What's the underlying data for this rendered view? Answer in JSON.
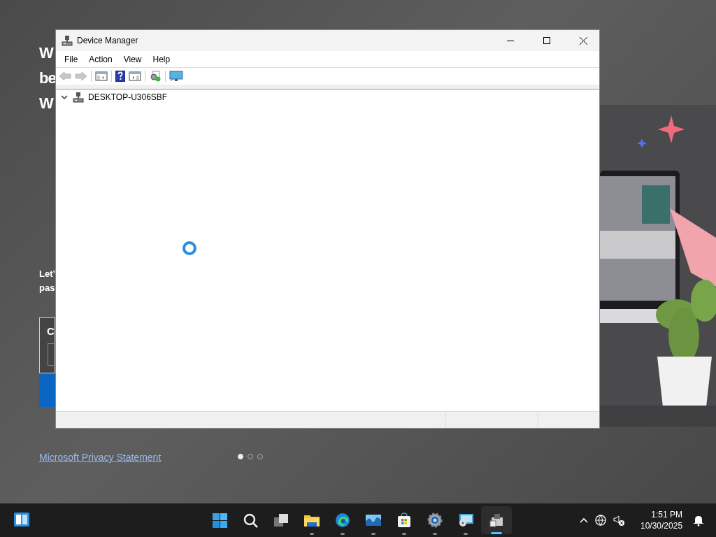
{
  "background_page": {
    "title_lines": [
      "W",
      "be",
      "W"
    ],
    "body_lines": [
      "Let’",
      "pas"
    ],
    "card_label": "C",
    "privacy_link": "Microsoft Privacy Statement",
    "pager": [
      {
        "selected": true
      },
      {
        "selected": false
      },
      {
        "selected": false
      }
    ]
  },
  "window": {
    "title": "Device Manager",
    "menu": [
      "File",
      "Action",
      "View",
      "Help"
    ],
    "toolbar": [
      {
        "kind": "back",
        "disabled": true
      },
      {
        "kind": "forward",
        "disabled": true
      },
      {
        "kind": "sep"
      },
      {
        "kind": "tree",
        "disabled": false
      },
      {
        "kind": "sep"
      },
      {
        "kind": "help"
      },
      {
        "kind": "pane",
        "disabled": false
      },
      {
        "kind": "sep"
      },
      {
        "kind": "scan"
      },
      {
        "kind": "sep"
      },
      {
        "kind": "monitor"
      }
    ],
    "tree": [
      {
        "label": "DESKTOP-U306SBF",
        "expanded": true
      }
    ]
  },
  "taskbar": {
    "apps": [
      {
        "kind": "start",
        "running": false,
        "active": false
      },
      {
        "kind": "search",
        "running": false,
        "active": false
      },
      {
        "kind": "taskview",
        "running": false,
        "active": false
      },
      {
        "kind": "explorer",
        "running": true,
        "active": false
      },
      {
        "kind": "edge",
        "running": true,
        "active": false
      },
      {
        "kind": "photos",
        "running": true,
        "active": false
      },
      {
        "kind": "store",
        "running": true,
        "active": false
      },
      {
        "kind": "settings",
        "running": true,
        "active": false
      },
      {
        "kind": "remote",
        "running": true,
        "active": false
      },
      {
        "kind": "devmgr",
        "running": true,
        "active": true
      }
    ],
    "time": "1:51 PM",
    "date": "10/30/2025"
  }
}
